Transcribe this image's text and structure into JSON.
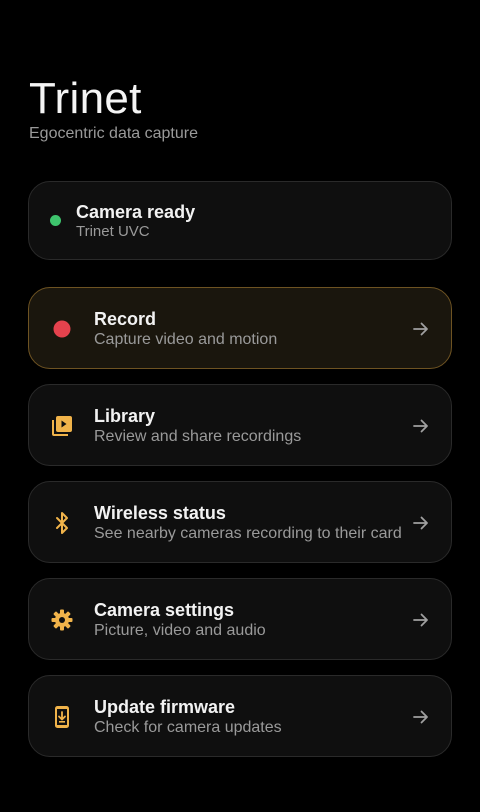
{
  "app": {
    "title": "Trinet",
    "subtitle": "Egocentric data capture"
  },
  "status": {
    "title": "Camera ready",
    "device": "Trinet UVC",
    "dot_color": "#3ec46d"
  },
  "menu": {
    "items": [
      {
        "title": "Record",
        "subtitle": "Capture video and motion",
        "icon": "record-dot-icon",
        "highlighted": true
      },
      {
        "title": "Library",
        "subtitle": "Review and share recordings",
        "icon": "video-library-icon"
      },
      {
        "title": "Wireless status",
        "subtitle": "See nearby cameras recording to their card",
        "icon": "bluetooth-icon"
      },
      {
        "title": "Camera settings",
        "subtitle": "Picture, video and audio",
        "icon": "gear-icon"
      },
      {
        "title": "Update firmware",
        "subtitle": "Check for camera updates",
        "icon": "device-download-icon"
      }
    ]
  },
  "colors": {
    "accent": "#f0b34a",
    "record": "#e5424d",
    "background": "#000000",
    "card": "#0f0f0f"
  }
}
